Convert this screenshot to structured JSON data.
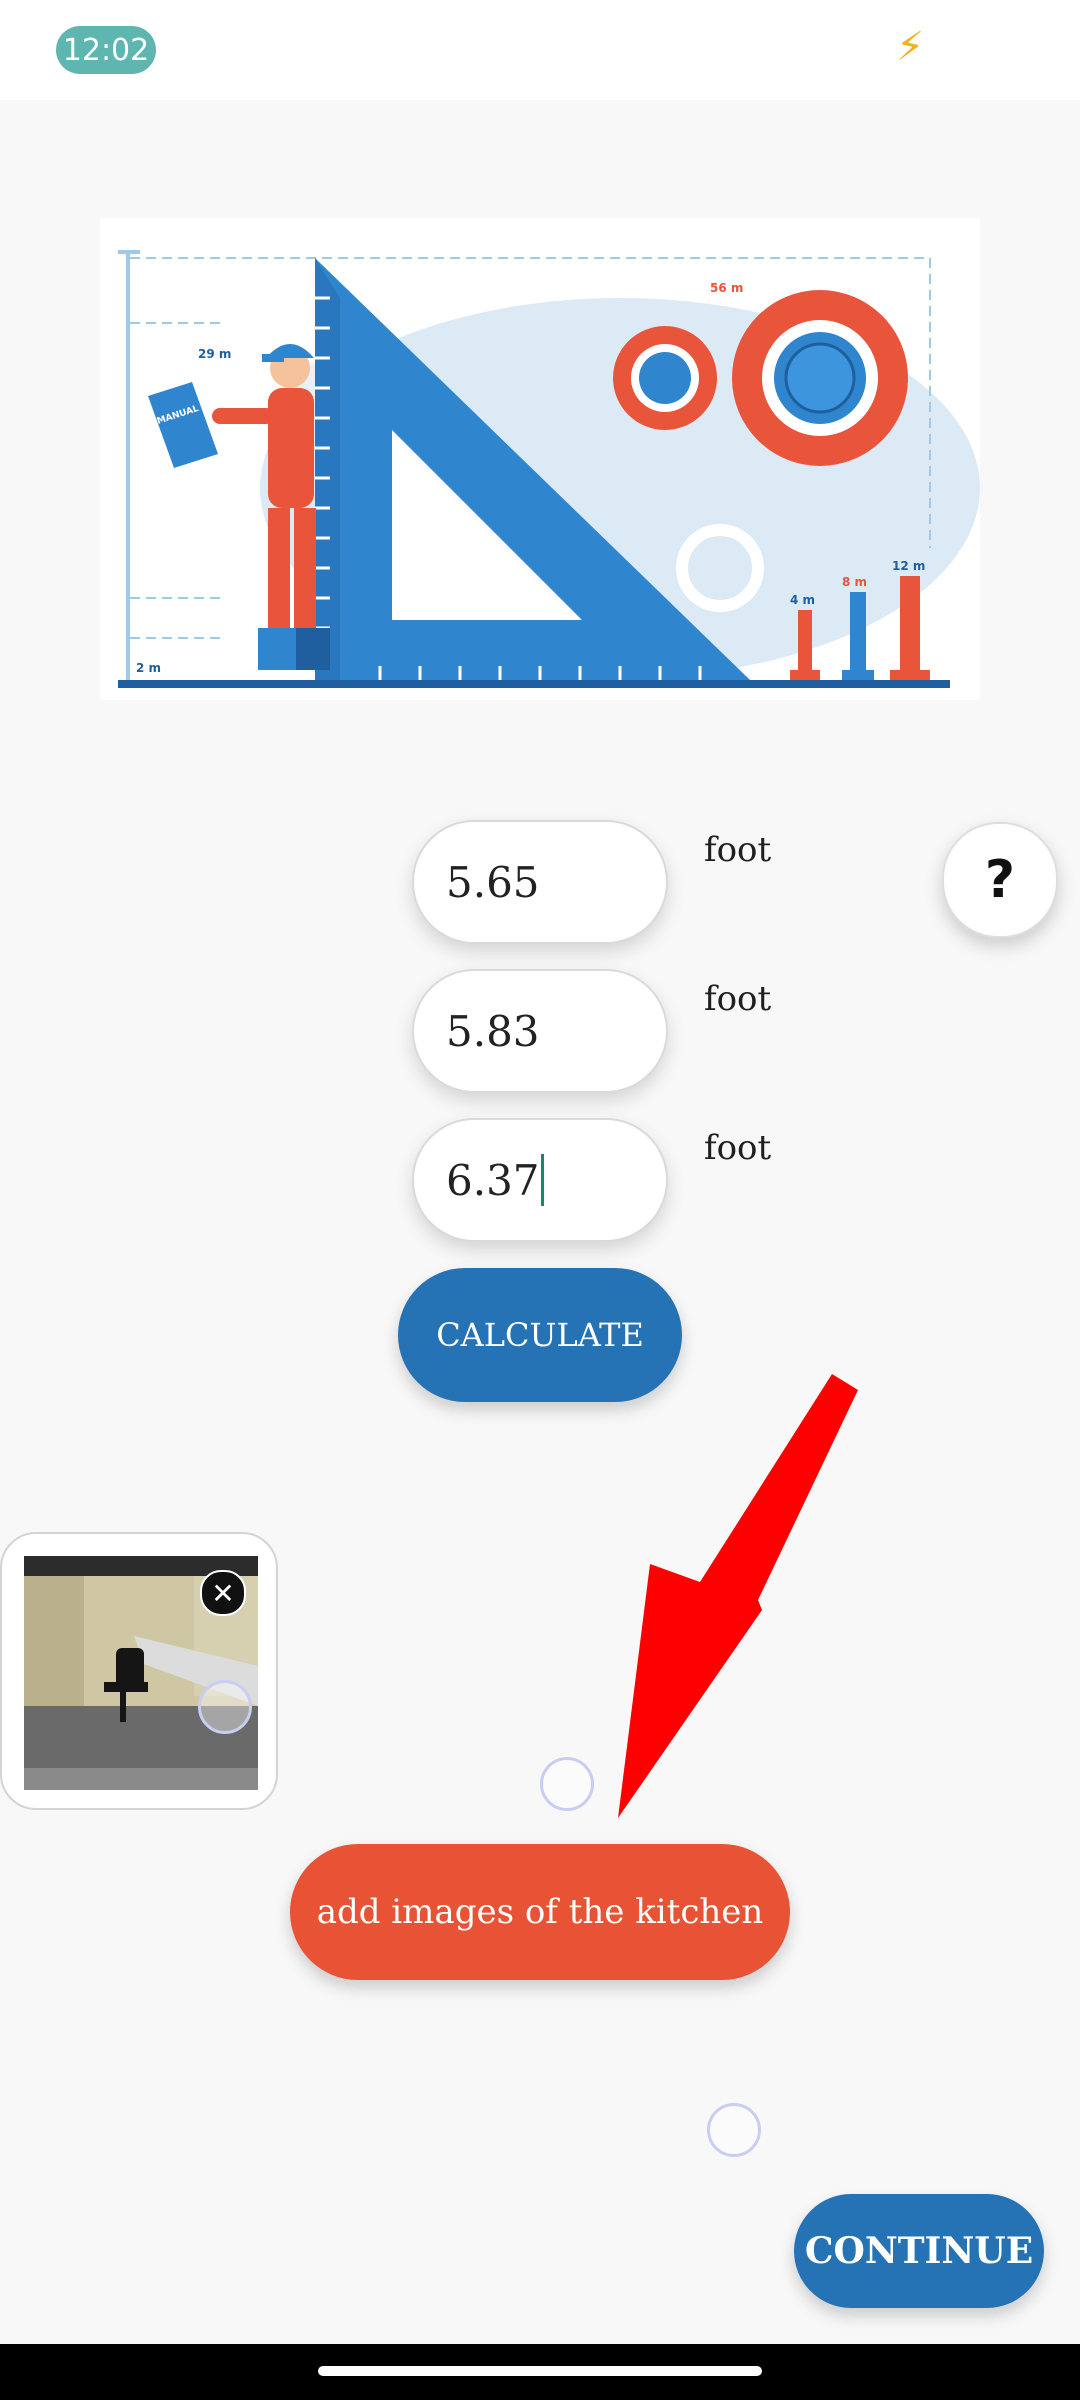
{
  "status_bar": {
    "time": "12:02",
    "bolt_icon": "lightning-bolt-icon"
  },
  "illustration": {
    "labels": {
      "m29": "29 m",
      "m2": "2 m",
      "m56": "56 m",
      "m4": "4 m",
      "m8": "8 m",
      "m12": "12 m",
      "book": "MANUAL BOOK"
    },
    "colors": {
      "blue": "#2f86cf",
      "dark_blue": "#1f5fa0",
      "orange": "#e8553b",
      "light_bg": "#dceaf6"
    }
  },
  "form": {
    "fields": [
      {
        "value": "5.65",
        "unit": "foot"
      },
      {
        "value": "5.83",
        "unit": "foot"
      },
      {
        "value": "6.37",
        "unit": "foot"
      }
    ],
    "help_label": "?",
    "calculate_label": "CALCULATE"
  },
  "images": {
    "remove_icon": "close-icon",
    "remove_label": "✕"
  },
  "actions": {
    "add_images_label": "add images of the kitchen",
    "continue_label": "CONTINUE"
  },
  "colors": {
    "primary": "#2573b5",
    "accent": "#e75334",
    "arrow": "#ff0000",
    "time_pill": "#5fb6b0"
  }
}
